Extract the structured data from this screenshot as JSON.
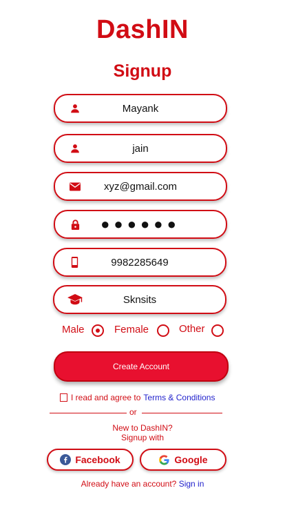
{
  "app": {
    "title": "DashIN"
  },
  "screen": {
    "title": "Signup"
  },
  "fields": [
    {
      "name": "first-name",
      "icon": "person-icon",
      "value": "Mayank"
    },
    {
      "name": "last-name",
      "icon": "person-icon",
      "value": "jain"
    },
    {
      "name": "email",
      "icon": "mail-icon",
      "value": "xyz@gmail.com"
    },
    {
      "name": "password",
      "icon": "lock-icon",
      "value": "●●●●●●"
    },
    {
      "name": "phone",
      "icon": "phone-icon",
      "value": "9982285649"
    },
    {
      "name": "college",
      "icon": "school-icon",
      "value": "Sknsits"
    }
  ],
  "gender": {
    "options": [
      "Male",
      "Female",
      "Other"
    ],
    "selected": "Male"
  },
  "create_button": {
    "label": "Create Account"
  },
  "terms": {
    "text": "I read and agree to",
    "link": "Terms & Conditions",
    "checked": false
  },
  "divider": {
    "label": "or"
  },
  "social": {
    "line1": "New to DashIN?",
    "line2": "Signup with",
    "facebook_label": "Facebook",
    "google_label": "Google"
  },
  "footer": {
    "text": "Already have an account?",
    "link": "Sign in"
  },
  "colors": {
    "primary": "#d10c14",
    "button": "#e8102f",
    "link": "#2222cc"
  }
}
